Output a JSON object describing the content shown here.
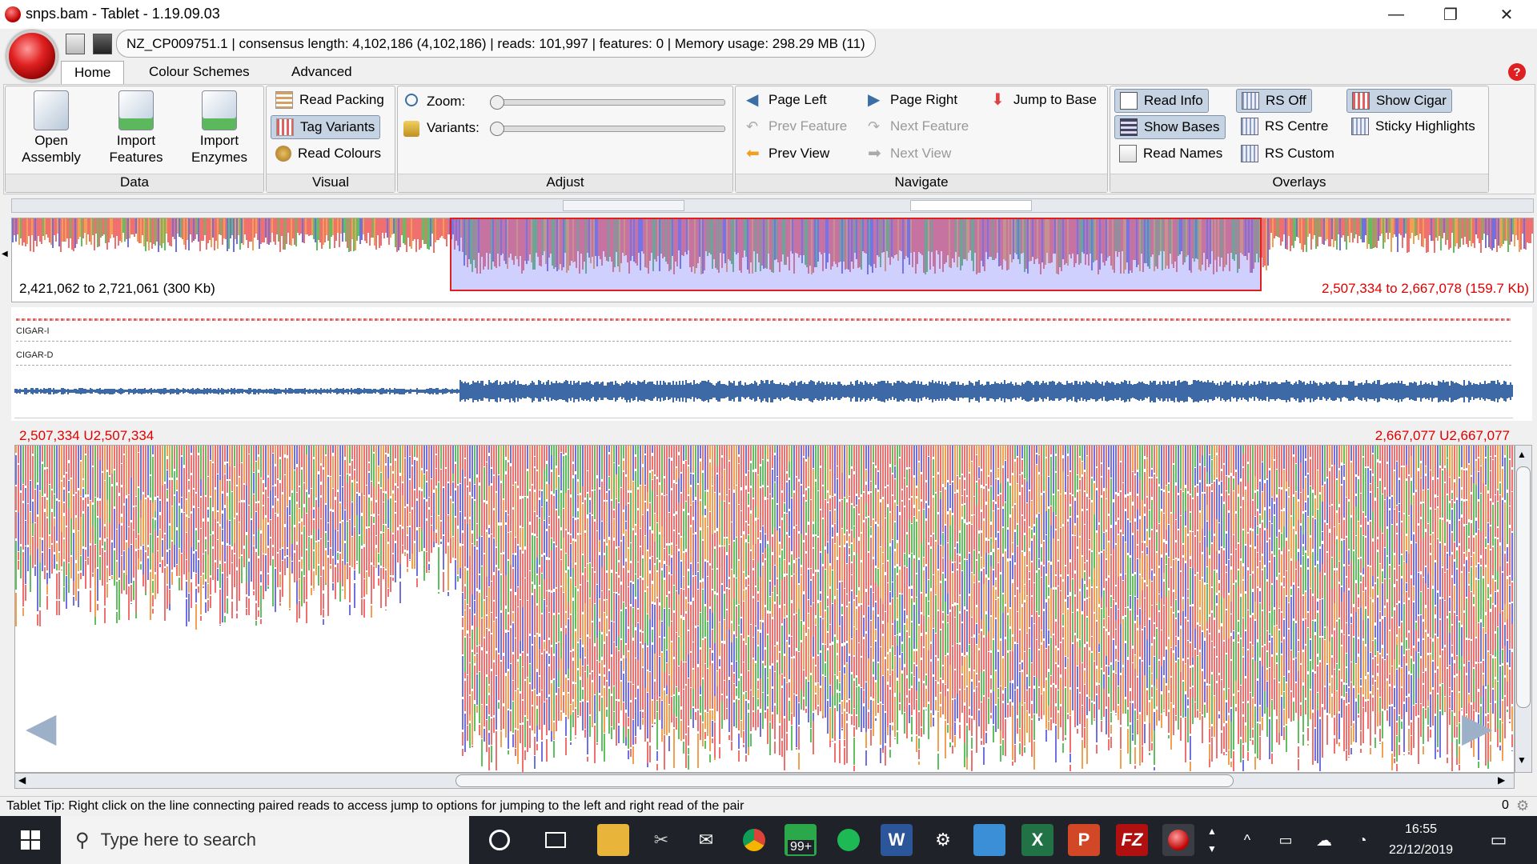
{
  "window": {
    "title": "snps.bam - Tablet - 1.19.09.03",
    "minimize_glyph": "—",
    "maximize_glyph": "❐",
    "close_glyph": "✕"
  },
  "infobar": {
    "text": "NZ_CP009751.1  |  consensus length: 4,102,186 (4,102,186)  |  reads: 101,997  |  features: 0  |  Memory usage: 298.29 MB (11)"
  },
  "tabs": [
    {
      "label": "Home",
      "active": true
    },
    {
      "label": "Colour Schemes",
      "active": false
    },
    {
      "label": "Advanced",
      "active": false
    }
  ],
  "help_glyph": "?",
  "ribbon": {
    "data": {
      "label": "Data",
      "buttons": [
        {
          "label": "Open\nAssembly",
          "icon": "open-assembly-icon"
        },
        {
          "label": "Import\nFeatures",
          "icon": "import-features-icon"
        },
        {
          "label": "Import\nEnzymes",
          "icon": "import-enzymes-icon"
        }
      ]
    },
    "visual": {
      "label": "Visual",
      "buttons": [
        "Read Packing",
        "Tag Variants",
        "Read Colours"
      ]
    },
    "adjust": {
      "label": "Adjust",
      "zoom_label": "Zoom:",
      "variants_label": "Variants:",
      "zoom_level": 0,
      "variants_level": 0
    },
    "navigate": {
      "label": "Navigate",
      "buttons": [
        "Page Left",
        "Page Right",
        "Jump to Base",
        "Prev Feature",
        "Next Feature",
        "Prev View",
        "Next View"
      ]
    },
    "overlays": {
      "label": "Overlays",
      "buttons": [
        "Read Info",
        "RS Off",
        "Show Cigar",
        "Show Bases",
        "RS Centre",
        "Sticky Highlights",
        "Read Names",
        "RS Custom"
      ]
    }
  },
  "overview": {
    "left_range": "2,421,062 to 2,721,061 (300 Kb)",
    "right_range": "2,507,334 to 2,667,078 (159.7 Kb)"
  },
  "tracks": {
    "cigar_i": "CIGAR-I",
    "cigar_d": "CIGAR-D"
  },
  "main": {
    "pos_left": "2,507,334 U2,507,334",
    "pos_right": "2,667,077 U2,667,077"
  },
  "status": {
    "tip": "Tablet Tip:  Right click on the line connecting paired reads to access jump to options for jumping to the left and right read of the pair",
    "count": "0"
  },
  "taskbar": {
    "search_placeholder": "Type here to search",
    "badge": "99+",
    "time": "16:55",
    "date": "22/12/2019"
  },
  "colors": {
    "read_red": "#f07070",
    "read_blue": "#7070e0",
    "read_green": "#60c060",
    "read_orange": "#f0a050",
    "accent_red": "#e00000",
    "coverage_blue": "#3d6aa6"
  }
}
